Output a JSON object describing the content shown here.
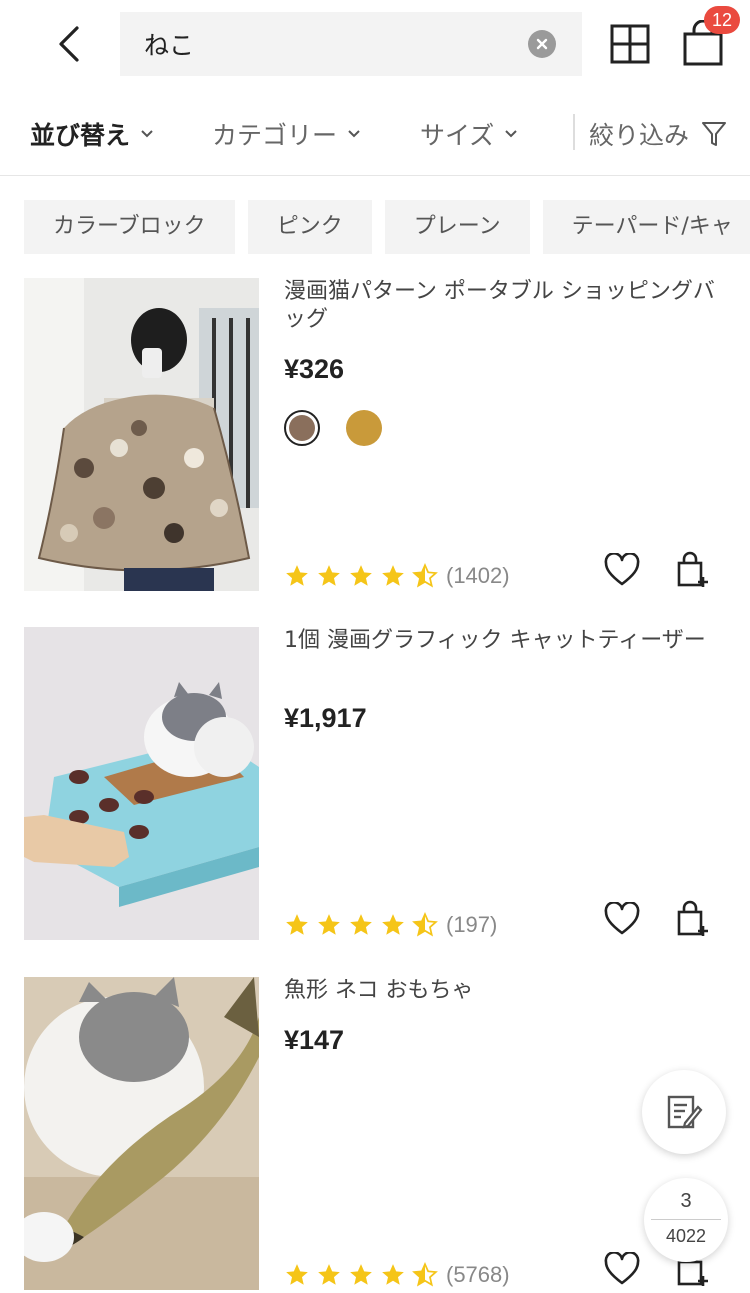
{
  "header": {
    "search_value": "ねこ",
    "cart_count": "12"
  },
  "filters": {
    "sort_label": "並び替え",
    "category_label": "カテゴリー",
    "size_label": "サイズ",
    "refine_label": "絞り込み"
  },
  "chips": [
    "カラーブロック",
    "ピンク",
    "プレーン",
    "テーパード/キャ"
  ],
  "products": [
    {
      "title": "漫画猫パターン ポータブル ショッピングバッグ",
      "price": "¥326",
      "rating": 4.5,
      "review_count": "(1402)",
      "swatch_colors": [
        "#8a6f5c",
        "#c99a3a"
      ]
    },
    {
      "title": "1個 漫画グラフィック キャットティーザー",
      "price": "¥1,917",
      "rating": 4.5,
      "review_count": "(197)"
    },
    {
      "title": "魚形 ネコ おもちゃ",
      "price": "¥147",
      "rating": 4.5,
      "review_count": "(5768)"
    }
  ],
  "pagination": {
    "current": "3",
    "total": "4022"
  },
  "colors": {
    "star": "#f5c518",
    "badge": "#ea4a3f"
  }
}
